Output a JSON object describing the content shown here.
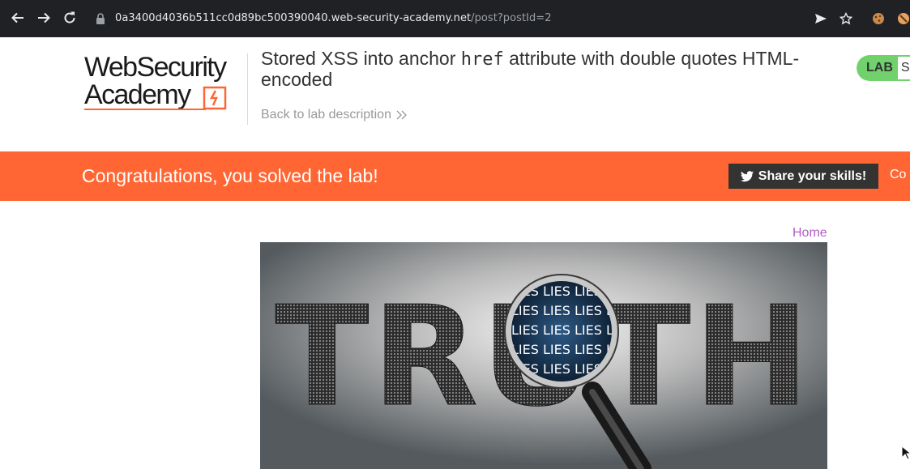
{
  "browser": {
    "url_host": "0a3400d4036b511cc0d89bc500390040.web-security-academy.net",
    "url_path": "/post?postId=2",
    "icons": [
      "back-icon",
      "forward-icon",
      "reload-icon",
      "lock-icon",
      "send-icon",
      "star-icon",
      "cookie-extension-icon",
      "extension-icon"
    ]
  },
  "header": {
    "logo_line1": "WebSecurity",
    "logo_line2": "Academy",
    "title_before": "Stored XSS into anchor ",
    "title_code": "href",
    "title_after": " attribute with double quotes HTML-encoded",
    "back_link": "Back to lab description",
    "lab_badge": "LAB",
    "lab_status": "S"
  },
  "banner": {
    "message": "Congratulations, you solved the lab!",
    "share_label": "Share your skills!",
    "continue_label": "Co"
  },
  "content": {
    "home_link": "Home",
    "image_word": "TRUTH",
    "image_lens_text": "LIES LIES LIES LI"
  },
  "colors": {
    "chrome_bg": "#202124",
    "accent": "#ff6633",
    "lab_green": "#70d16d",
    "dark_button": "#333332",
    "link_purple": "#b25ec6"
  }
}
